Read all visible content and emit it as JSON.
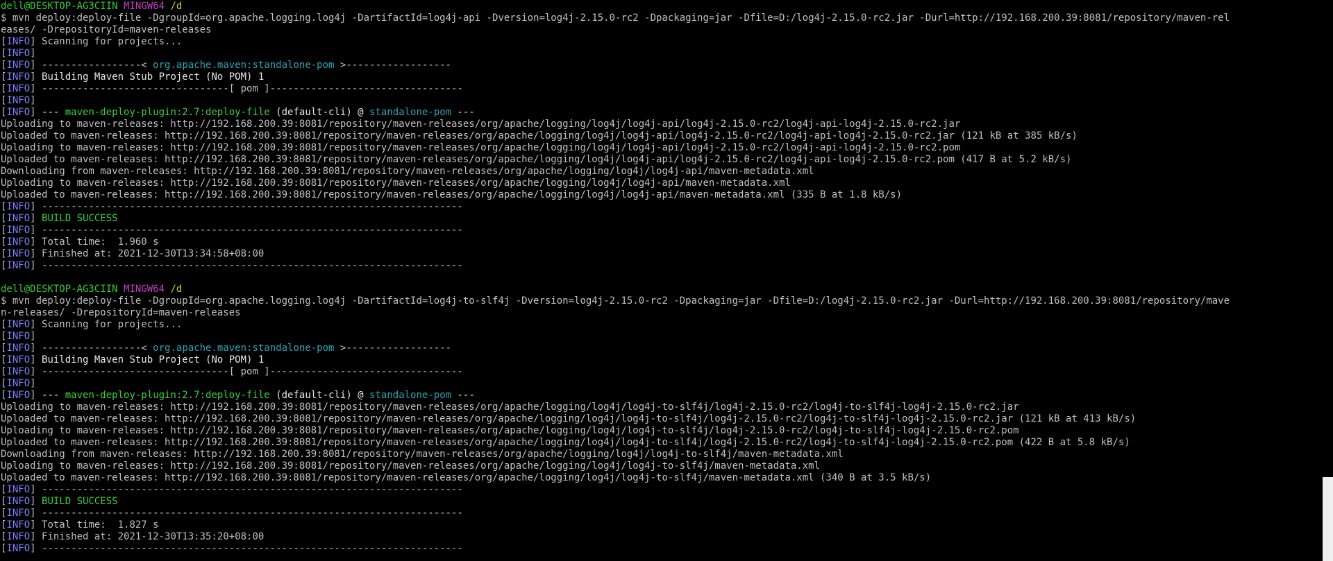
{
  "colors": {
    "background": "#000000",
    "default": "#c0c0c0",
    "green": "#33cc33",
    "magenta": "#c040c0",
    "yellow": "#cccc33",
    "info": "#7f7fff",
    "cyan": "#2aa5b5",
    "bright": "#39d239",
    "white": "#e8e8e8"
  },
  "terminal": {
    "lines": [
      [
        [
          "green",
          "dell@DESKTOP-AG3CIIN "
        ],
        [
          "magenta",
          "MINGW64 "
        ],
        [
          "yellow",
          "/d"
        ]
      ],
      [
        [
          "default",
          "$ mvn deploy:deploy-file -DgroupId=org.apache.logging.log4j -DartifactId=log4j-api -Dversion=log4j-2.15.0-rc2 -Dpackaging=jar -Dfile=D:/log4j-2.15.0-rc2.jar -Durl=http://192.168.200.39:8081/repository/maven-rel"
        ]
      ],
      [
        [
          "default",
          "eases/ -DrepositoryId=maven-releases"
        ]
      ],
      [
        [
          "default",
          "["
        ],
        [
          "info",
          "INFO"
        ],
        [
          "default",
          "] Scanning for projects..."
        ]
      ],
      [
        [
          "default",
          "["
        ],
        [
          "info",
          "INFO"
        ],
        [
          "default",
          "]"
        ]
      ],
      [
        [
          "default",
          "["
        ],
        [
          "info",
          "INFO"
        ],
        [
          "default",
          "] -----------------< "
        ],
        [
          "cyan",
          "org.apache.maven:standalone-pom"
        ],
        [
          "default",
          " >------------------"
        ]
      ],
      [
        [
          "default",
          "["
        ],
        [
          "info",
          "INFO"
        ],
        [
          "default",
          "] "
        ],
        [
          "white",
          "Building Maven Stub Project (No POM) 1"
        ]
      ],
      [
        [
          "default",
          "["
        ],
        [
          "info",
          "INFO"
        ],
        [
          "default",
          "] --------------------------------[ pom ]---------------------------------"
        ]
      ],
      [
        [
          "default",
          "["
        ],
        [
          "info",
          "INFO"
        ],
        [
          "default",
          "]"
        ]
      ],
      [
        [
          "default",
          "["
        ],
        [
          "info",
          "INFO"
        ],
        [
          "default",
          "] "
        ],
        [
          "white",
          "--- "
        ],
        [
          "bright",
          "maven-deploy-plugin:2.7:deploy-file"
        ],
        [
          "white",
          " (default-cli) @ "
        ],
        [
          "cyan",
          "standalone-pom"
        ],
        [
          "white",
          " ---"
        ]
      ],
      [
        [
          "default",
          "Uploading to maven-releases: http://192.168.200.39:8081/repository/maven-releases/org/apache/logging/log4j/log4j-api/log4j-2.15.0-rc2/log4j-api-log4j-2.15.0-rc2.jar"
        ]
      ],
      [
        [
          "default",
          "Uploaded to maven-releases: http://192.168.200.39:8081/repository/maven-releases/org/apache/logging/log4j/log4j-api/log4j-2.15.0-rc2/log4j-api-log4j-2.15.0-rc2.jar (121 kB at 385 kB/s)"
        ]
      ],
      [
        [
          "default",
          "Uploading to maven-releases: http://192.168.200.39:8081/repository/maven-releases/org/apache/logging/log4j/log4j-api/log4j-2.15.0-rc2/log4j-api-log4j-2.15.0-rc2.pom"
        ]
      ],
      [
        [
          "default",
          "Uploaded to maven-releases: http://192.168.200.39:8081/repository/maven-releases/org/apache/logging/log4j/log4j-api/log4j-2.15.0-rc2/log4j-api-log4j-2.15.0-rc2.pom (417 B at 5.2 kB/s)"
        ]
      ],
      [
        [
          "default",
          "Downloading from maven-releases: http://192.168.200.39:8081/repository/maven-releases/org/apache/logging/log4j/log4j-api/maven-metadata.xml"
        ]
      ],
      [
        [
          "default",
          "Uploading to maven-releases: http://192.168.200.39:8081/repository/maven-releases/org/apache/logging/log4j/log4j-api/maven-metadata.xml"
        ]
      ],
      [
        [
          "default",
          "Uploaded to maven-releases: http://192.168.200.39:8081/repository/maven-releases/org/apache/logging/log4j/log4j-api/maven-metadata.xml (335 B at 1.8 kB/s)"
        ]
      ],
      [
        [
          "default",
          "["
        ],
        [
          "info",
          "INFO"
        ],
        [
          "default",
          "] ------------------------------------------------------------------------"
        ]
      ],
      [
        [
          "default",
          "["
        ],
        [
          "info",
          "INFO"
        ],
        [
          "default",
          "] "
        ],
        [
          "bright",
          "BUILD SUCCESS"
        ]
      ],
      [
        [
          "default",
          "["
        ],
        [
          "info",
          "INFO"
        ],
        [
          "default",
          "] ------------------------------------------------------------------------"
        ]
      ],
      [
        [
          "default",
          "["
        ],
        [
          "info",
          "INFO"
        ],
        [
          "default",
          "] Total time:  1.960 s"
        ]
      ],
      [
        [
          "default",
          "["
        ],
        [
          "info",
          "INFO"
        ],
        [
          "default",
          "] Finished at: 2021-12-30T13:34:58+08:00"
        ]
      ],
      [
        [
          "default",
          "["
        ],
        [
          "info",
          "INFO"
        ],
        [
          "default",
          "] ------------------------------------------------------------------------"
        ]
      ],
      [
        [
          "default",
          ""
        ]
      ],
      [
        [
          "green",
          "dell@DESKTOP-AG3CIIN "
        ],
        [
          "magenta",
          "MINGW64 "
        ],
        [
          "yellow",
          "/d"
        ]
      ],
      [
        [
          "default",
          "$ mvn deploy:deploy-file -DgroupId=org.apache.logging.log4j -DartifactId=log4j-to-slf4j -Dversion=log4j-2.15.0-rc2 -Dpackaging=jar -Dfile=D:/log4j-2.15.0-rc2.jar -Durl=http://192.168.200.39:8081/repository/mave"
        ]
      ],
      [
        [
          "default",
          "n-releases/ -DrepositoryId=maven-releases"
        ]
      ],
      [
        [
          "default",
          "["
        ],
        [
          "info",
          "INFO"
        ],
        [
          "default",
          "] Scanning for projects..."
        ]
      ],
      [
        [
          "default",
          "["
        ],
        [
          "info",
          "INFO"
        ],
        [
          "default",
          "]"
        ]
      ],
      [
        [
          "default",
          "["
        ],
        [
          "info",
          "INFO"
        ],
        [
          "default",
          "] -----------------< "
        ],
        [
          "cyan",
          "org.apache.maven:standalone-pom"
        ],
        [
          "default",
          " >------------------"
        ]
      ],
      [
        [
          "default",
          "["
        ],
        [
          "info",
          "INFO"
        ],
        [
          "default",
          "] "
        ],
        [
          "white",
          "Building Maven Stub Project (No POM) 1"
        ]
      ],
      [
        [
          "default",
          "["
        ],
        [
          "info",
          "INFO"
        ],
        [
          "default",
          "] --------------------------------[ pom ]---------------------------------"
        ]
      ],
      [
        [
          "default",
          "["
        ],
        [
          "info",
          "INFO"
        ],
        [
          "default",
          "]"
        ]
      ],
      [
        [
          "default",
          "["
        ],
        [
          "info",
          "INFO"
        ],
        [
          "default",
          "] "
        ],
        [
          "white",
          "--- "
        ],
        [
          "bright",
          "maven-deploy-plugin:2.7:deploy-file"
        ],
        [
          "white",
          " (default-cli) @ "
        ],
        [
          "cyan",
          "standalone-pom"
        ],
        [
          "white",
          " ---"
        ]
      ],
      [
        [
          "default",
          "Uploading to maven-releases: http://192.168.200.39:8081/repository/maven-releases/org/apache/logging/log4j/log4j-to-slf4j/log4j-2.15.0-rc2/log4j-to-slf4j-log4j-2.15.0-rc2.jar"
        ]
      ],
      [
        [
          "default",
          "Uploaded to maven-releases: http://192.168.200.39:8081/repository/maven-releases/org/apache/logging/log4j/log4j-to-slf4j/log4j-2.15.0-rc2/log4j-to-slf4j-log4j-2.15.0-rc2.jar (121 kB at 413 kB/s)"
        ]
      ],
      [
        [
          "default",
          "Uploading to maven-releases: http://192.168.200.39:8081/repository/maven-releases/org/apache/logging/log4j/log4j-to-slf4j/log4j-2.15.0-rc2/log4j-to-slf4j-log4j-2.15.0-rc2.pom"
        ]
      ],
      [
        [
          "default",
          "Uploaded to maven-releases: http://192.168.200.39:8081/repository/maven-releases/org/apache/logging/log4j/log4j-to-slf4j/log4j-2.15.0-rc2/log4j-to-slf4j-log4j-2.15.0-rc2.pom (422 B at 5.8 kB/s)"
        ]
      ],
      [
        [
          "default",
          "Downloading from maven-releases: http://192.168.200.39:8081/repository/maven-releases/org/apache/logging/log4j/log4j-to-slf4j/maven-metadata.xml"
        ]
      ],
      [
        [
          "default",
          "Uploading to maven-releases: http://192.168.200.39:8081/repository/maven-releases/org/apache/logging/log4j/log4j-to-slf4j/maven-metadata.xml"
        ]
      ],
      [
        [
          "default",
          "Uploaded to maven-releases: http://192.168.200.39:8081/repository/maven-releases/org/apache/logging/log4j/log4j-to-slf4j/maven-metadata.xml (340 B at 3.5 kB/s)"
        ]
      ],
      [
        [
          "default",
          "["
        ],
        [
          "info",
          "INFO"
        ],
        [
          "default",
          "] ------------------------------------------------------------------------"
        ]
      ],
      [
        [
          "default",
          "["
        ],
        [
          "info",
          "INFO"
        ],
        [
          "default",
          "] "
        ],
        [
          "bright",
          "BUILD SUCCESS"
        ]
      ],
      [
        [
          "default",
          "["
        ],
        [
          "info",
          "INFO"
        ],
        [
          "default",
          "] ------------------------------------------------------------------------"
        ]
      ],
      [
        [
          "default",
          "["
        ],
        [
          "info",
          "INFO"
        ],
        [
          "default",
          "] Total time:  1.827 s"
        ]
      ],
      [
        [
          "default",
          "["
        ],
        [
          "info",
          "INFO"
        ],
        [
          "default",
          "] Finished at: 2021-12-30T13:35:20+08:00"
        ]
      ],
      [
        [
          "default",
          "["
        ],
        [
          "info",
          "INFO"
        ],
        [
          "default",
          "] ------------------------------------------------------------------------"
        ]
      ]
    ]
  }
}
